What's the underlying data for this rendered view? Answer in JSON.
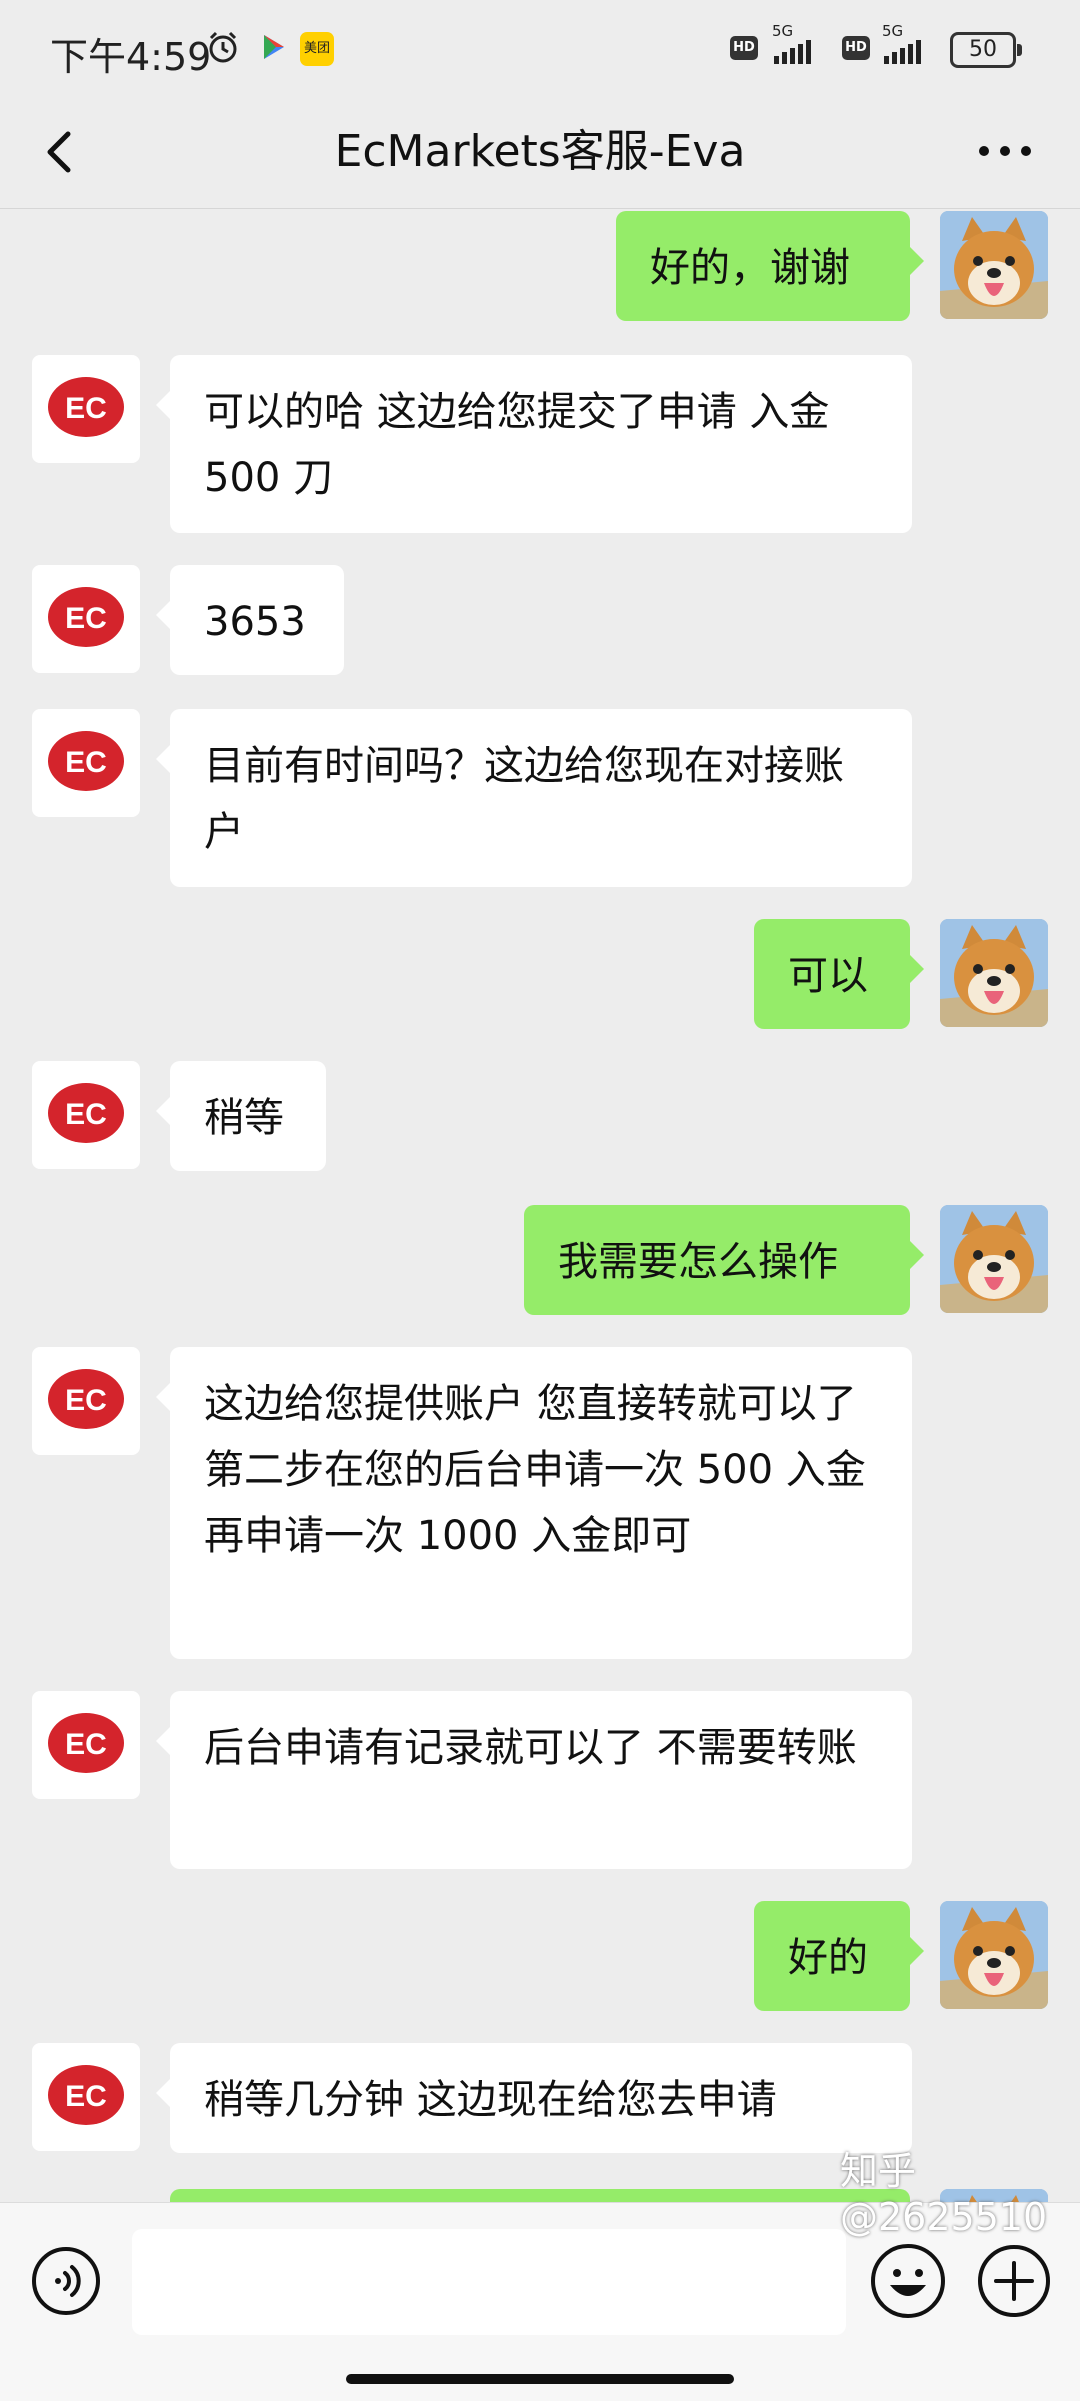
{
  "status_bar": {
    "time": "下午4:59",
    "app_badge": "美团",
    "network_1": "5G",
    "network_2": "5G",
    "hd_1": "HD",
    "hd_2": "HD",
    "battery": "50",
    "icons": [
      "alarm-icon",
      "play-store-icon",
      "meituan-icon",
      "signal-icon",
      "battery-icon"
    ]
  },
  "nav": {
    "title": "EcMarkets客服-Eva",
    "back_icon": "chevron-left-icon",
    "more_icon": "more-dots-icon"
  },
  "messages": [
    {
      "side": "out",
      "text": "好的，谢谢"
    },
    {
      "side": "in",
      "text": "可以的哈 这边给您提交了申请 入金 500 刀"
    },
    {
      "side": "in",
      "text": "3653"
    },
    {
      "side": "in",
      "text": "目前有时间吗？这边给您现在对接账户"
    },
    {
      "side": "out",
      "text": "可以"
    },
    {
      "side": "in",
      "text": "稍等"
    },
    {
      "side": "out",
      "text": "我需要怎么操作"
    },
    {
      "side": "in",
      "text": "这边给您提供账户 您直接转就可以了 第二步在您的后台申请一次 500 入金 再申请一次 1000 入金即可"
    },
    {
      "side": "in",
      "text": "后台申请有记录就可以了 不需要转账"
    },
    {
      "side": "out",
      "text": "好的"
    },
    {
      "side": "in",
      "text": "稍等几分钟 这边现在给您去申请"
    }
  ],
  "avatars": {
    "agent_logo_text": "EC",
    "agent": "ec-logo-avatar",
    "user": "shiba-dog-avatar"
  },
  "input_bar": {
    "voice_icon": "voice-icon",
    "emoji_icon": "emoji-icon",
    "plus_icon": "plus-icon",
    "value": ""
  },
  "watermark": "知乎 @2625510",
  "colors": {
    "background": "#ededed",
    "incoming_bubble": "#ffffff",
    "outgoing_bubble": "#95ec69",
    "ec_logo": "#d4242c"
  }
}
